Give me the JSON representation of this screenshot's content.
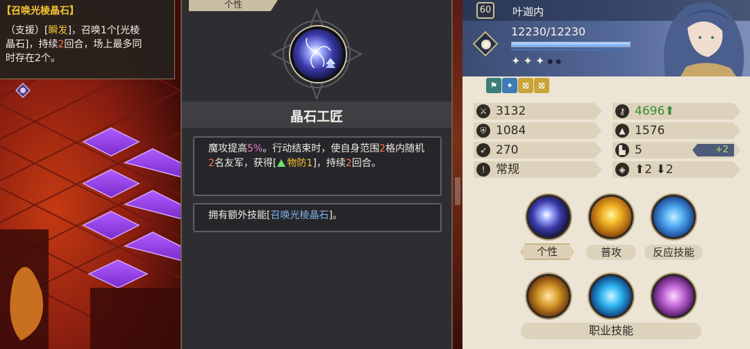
{
  "map_tooltip": {
    "title": "【召唤光棱晶石】",
    "line1_a": "（支援）[",
    "line1_kw": "瞬发",
    "line1_b": "]，召唤1个[光棱",
    "line2_a": "晶石]，持续",
    "line2_num": "2",
    "line2_b": "回合，场上最多同",
    "line3": "时存在2个。"
  },
  "talent": {
    "tab_label": "个性",
    "icon": "crystal-swirl-icon",
    "name": "晶石工匠",
    "desc1_a": "魔攻提高",
    "desc1_pct": "5%",
    "desc1_b": "。行动结束时，使自身范围",
    "desc1_range": "2",
    "desc1_c": "格内随机",
    "desc1_count": "2",
    "desc1_d": "名友军，获得[",
    "desc1_buff": "物防1",
    "desc1_e": "]，持续",
    "desc1_turns": "2",
    "desc1_f": "回合。",
    "desc2_a": "拥有额外技能[",
    "desc2_skill": "召唤光棱晶石",
    "desc2_b": "]。"
  },
  "character": {
    "level": "60",
    "name": "叶迦内",
    "hp": "12230/12230",
    "hp_ratio": 1.0,
    "stars_on": "✦✦✦",
    "stars_off": "●●",
    "buffs": [
      "sprint-icon",
      "wing-icon",
      "cross-icon",
      "cross-icon"
    ],
    "stats": {
      "attack": "3132",
      "magic_attack": "4696",
      "magic_attack_arrow": "⬆",
      "defense": "1084",
      "magic_defense": "1576",
      "range": "270",
      "movement": "5",
      "movement_bonus": "+2",
      "type": "常规",
      "elevation_up": "⬆2",
      "elevation_down": "⬇2"
    },
    "skills": {
      "talent_label": "个性",
      "normal_label": "普攻",
      "reaction_label": "反应技能",
      "job_label": "职业技能"
    }
  },
  "colors": {
    "accent_gold": "#f4c431",
    "accent_red": "#ff7a52",
    "accent_purple": "#e37ac9",
    "accent_blue": "#7fb2e6",
    "bonus_green": "#3a8b3a"
  }
}
